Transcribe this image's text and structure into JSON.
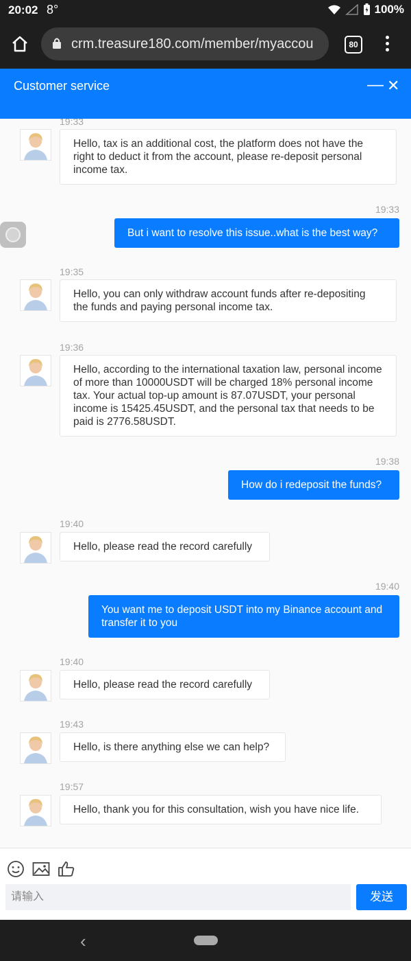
{
  "status_bar": {
    "time": "20:02",
    "temperature": "8°",
    "battery": "100%"
  },
  "browser": {
    "url": "crm.treasure180.com/member/myaccou",
    "tab_count": "80"
  },
  "header": {
    "title": "Customer service"
  },
  "messages": [
    {
      "dir": "in",
      "time": "19:33",
      "text": "Hello, tax is an additional cost, the platform does not have the right to deduct it from the account, please re-deposit personal income tax."
    },
    {
      "dir": "out",
      "time": "19:33",
      "text": "But i want to resolve this issue..what is the best way?"
    },
    {
      "dir": "in",
      "time": "19:35",
      "text": "Hello, you can only withdraw account funds after re-depositing the funds and paying personal income tax."
    },
    {
      "dir": "in",
      "time": "19:36",
      "text": "Hello, according to the international taxation law, personal income of more than 10000USDT will be charged 18% personal income tax. Your actual top-up amount is 87.07USDT, your personal income is 15425.45USDT, and the personal tax that needs to be paid is 2776.58USDT."
    },
    {
      "dir": "out",
      "time": "19:38",
      "text": "How do i redeposit the funds?"
    },
    {
      "dir": "in",
      "time": "19:40",
      "text": "Hello, please read the record carefully"
    },
    {
      "dir": "out",
      "time": "19:40",
      "text": "You want me to deposit USDT into my Binance account and transfer it to you"
    },
    {
      "dir": "in",
      "time": "19:40",
      "text": "Hello, please read the record carefully"
    },
    {
      "dir": "in",
      "time": "19:43",
      "text": "Hello, is there anything else we can help?"
    },
    {
      "dir": "in",
      "time": "19:57",
      "text": "Hello, thank you for this consultation, wish you have nice life."
    }
  ],
  "composer": {
    "placeholder": "请输入",
    "send_label": "发送"
  },
  "icons": {
    "emoji": "smile-icon",
    "image": "image-icon",
    "like": "thumbs-up-icon"
  },
  "colors": {
    "accent": "#0a7cff",
    "chrome": "#1e1e1e"
  }
}
